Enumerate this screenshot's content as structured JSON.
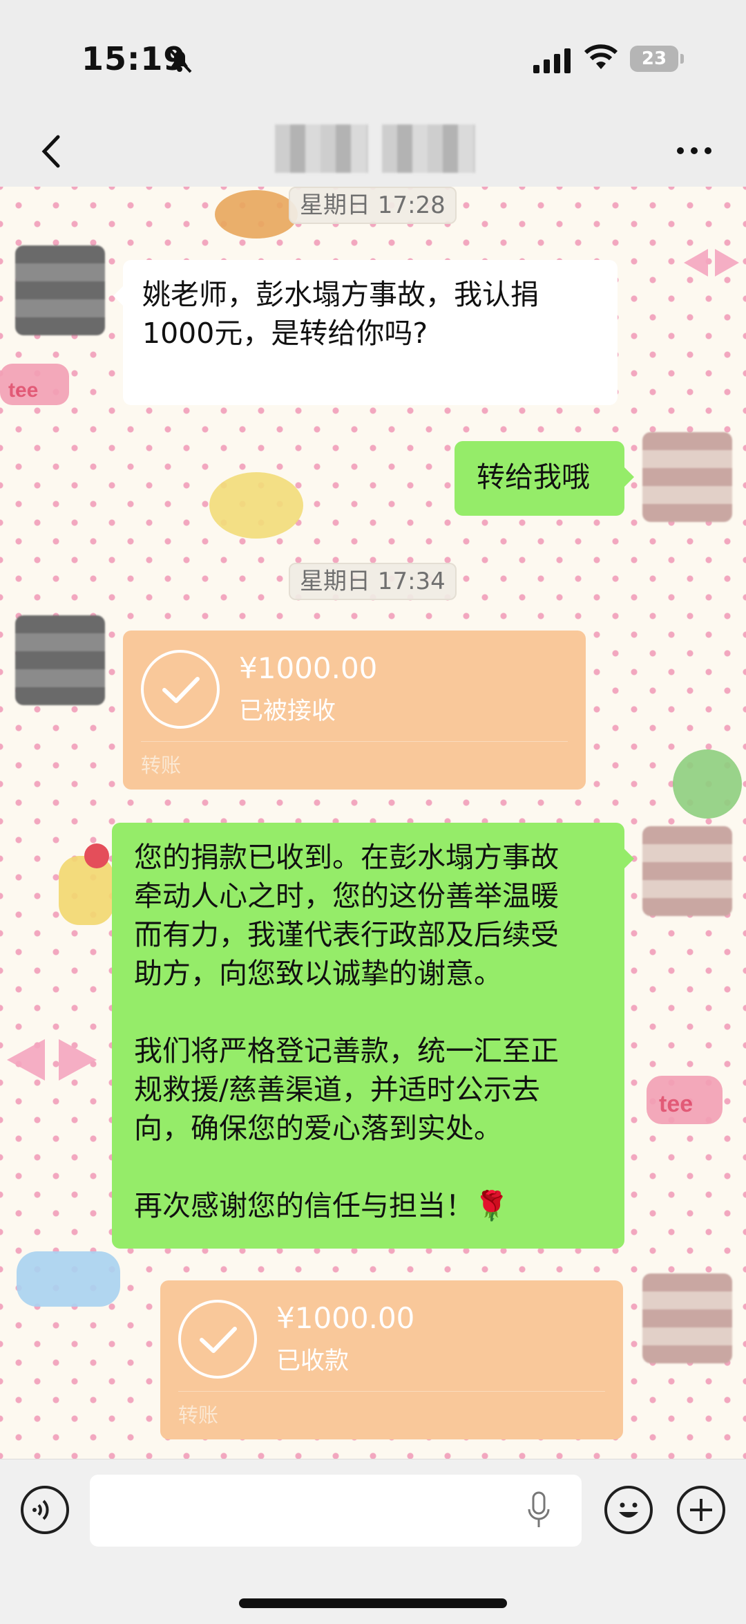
{
  "status_bar": {
    "time": "15:19",
    "battery": "23"
  },
  "nav": {
    "title_part1": "",
    "title_part2": ""
  },
  "messages": {
    "divider1": "星期日 17:28",
    "msg1": "姚老师，彭水塌方事故，我认捐\n1000元，是转给你吗?",
    "msg2": "转给我哦",
    "divider2": "星期日 17:34",
    "transfer1": {
      "amount": "¥1000.00",
      "status": "已被接收",
      "label": "转账"
    },
    "msg3": "您的捐款已收到。在彭水塌方事故\n牵动人心之时，您的这份善举温暖\n而有力，我谨代表行政部及后续受\n助方，向您致以诚挚的谢意。\n\n我们将严格登记善款，统一汇至正\n规救援/慈善渠道，并适时公示去\n向，确保您的爱心落到实处。\n\n再次感谢您的信任与担当！🌹",
    "transfer2": {
      "amount": "¥1000.00",
      "status": "已收款",
      "label": "转账"
    }
  },
  "decor": {
    "sticker_tee": "tee",
    "sticker_cup": "tee"
  },
  "colors": {
    "green_bubble": "#95ec69",
    "transfer_card": "#f9c89a",
    "bar_bg": "#ededed"
  }
}
